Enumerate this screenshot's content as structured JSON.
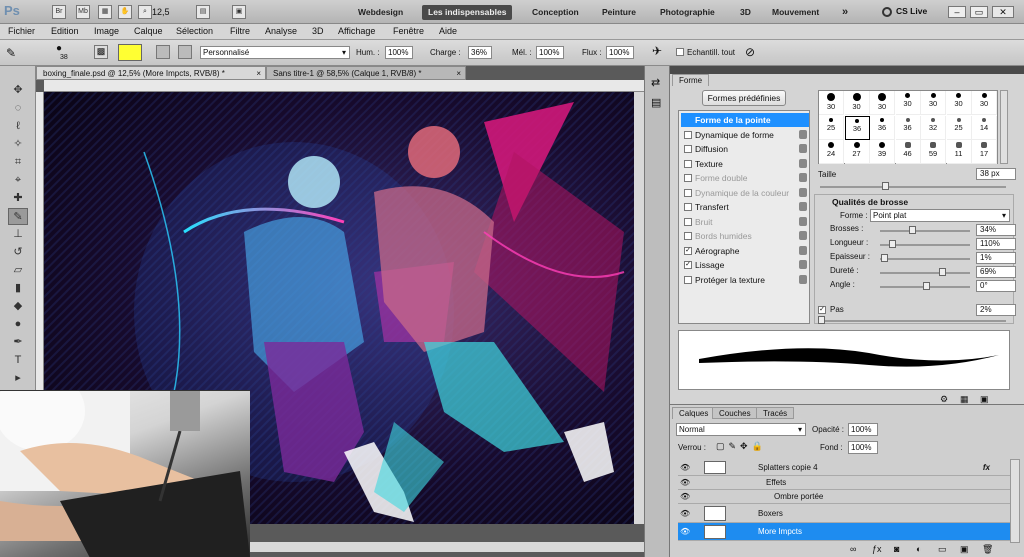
{
  "app": {
    "logo": "Ps",
    "zoom": "12,5",
    "cs_live": "CS Live"
  },
  "workspaces": [
    "Webdesign",
    "Les indispensables",
    "Conception",
    "Peinture",
    "Photographie",
    "3D",
    "Mouvement"
  ],
  "workspaces_more": "»",
  "menus": [
    "Fichier",
    "Edition",
    "Image",
    "Calque",
    "Sélection",
    "Filtre",
    "Analyse",
    "3D",
    "Affichage",
    "Fenêtre",
    "Aide"
  ],
  "options": {
    "brush_size": "38",
    "fg_color": "#ffff33",
    "preset": "Personnalisé",
    "hum_label": "Hum. :",
    "hum_value": "100%",
    "charge_label": "Charge :",
    "charge_value": "36%",
    "mel_label": "Mél. :",
    "mel_value": "100%",
    "flux_label": "Flux :",
    "flux_value": "100%",
    "sample_all": "Echantill. tout"
  },
  "tabs": [
    {
      "label": "boxing_finale.psd @ 12,5% (More Impcts, RVB/8) *",
      "close": "×"
    },
    {
      "label": "Sans titre-1 @ 58,5% (Calque 1, RVB/8) *",
      "close": "×"
    }
  ],
  "brush_panel": {
    "tab": "Forme",
    "presets_button": "Formes prédéfinies",
    "options": [
      {
        "label": "Forme de la pointe",
        "checkbox": false,
        "checked": false,
        "selected": true,
        "disabled": false
      },
      {
        "label": "Dynamique de forme",
        "checkbox": true,
        "checked": false,
        "selected": false,
        "disabled": false
      },
      {
        "label": "Diffusion",
        "checkbox": true,
        "checked": false,
        "selected": false,
        "disabled": false
      },
      {
        "label": "Texture",
        "checkbox": true,
        "checked": false,
        "selected": false,
        "disabled": false
      },
      {
        "label": "Forme double",
        "checkbox": true,
        "checked": false,
        "selected": false,
        "disabled": true
      },
      {
        "label": "Dynamique de la couleur",
        "checkbox": true,
        "checked": false,
        "selected": false,
        "disabled": true
      },
      {
        "label": "Transfert",
        "checkbox": true,
        "checked": false,
        "selected": false,
        "disabled": false
      },
      {
        "label": "Bruit",
        "checkbox": true,
        "checked": false,
        "selected": false,
        "disabled": true
      },
      {
        "label": "Bords humides",
        "checkbox": true,
        "checked": false,
        "selected": false,
        "disabled": true
      },
      {
        "label": "Aérographe",
        "checkbox": true,
        "checked": true,
        "selected": false,
        "disabled": false
      },
      {
        "label": "Lissage",
        "checkbox": true,
        "checked": true,
        "selected": false,
        "disabled": false
      },
      {
        "label": "Protéger la texture",
        "checkbox": true,
        "checked": false,
        "selected": false,
        "disabled": false
      }
    ],
    "tips": [
      "30",
      "30",
      "30",
      "30",
      "30",
      "30",
      "30",
      "25",
      "36",
      "36",
      "36",
      "32",
      "25",
      "14",
      "24",
      "27",
      "39",
      "46",
      "59",
      "11",
      "17"
    ],
    "size_label": "Taille",
    "size_value": "38 px",
    "qualities_title": "Qualités de brosse",
    "shape_label": "Forme :",
    "shape_value": "Point plat",
    "params": [
      {
        "label": "Brosses :",
        "value": "34%"
      },
      {
        "label": "Longueur :",
        "value": "110%"
      },
      {
        "label": "Epaisseur :",
        "value": "1%"
      },
      {
        "label": "Dureté :",
        "value": "69%"
      },
      {
        "label": "Angle :",
        "value": "0°"
      }
    ],
    "pas_label": "Pas",
    "pas_value": "2%"
  },
  "layers_panel": {
    "tabs": [
      "Calques",
      "Couches",
      "Tracés"
    ],
    "blend": "Normal",
    "opacity_label": "Opacité :",
    "opacity_value": "100%",
    "lock_label": "Verrou :",
    "fill_label": "Fond :",
    "fill_value": "100%",
    "layers": [
      {
        "name": "Splatters copie 4",
        "fx": "fx"
      },
      {
        "name": "Effets",
        "fx": ""
      },
      {
        "name": "Ombre portée",
        "fx": ""
      },
      {
        "name": "Boxers",
        "fx": ""
      },
      {
        "name": "More Impcts",
        "fx": ""
      }
    ],
    "footer_icons": [
      "link-icon",
      "fx-icon",
      "mask-icon",
      "adjustment-icon",
      "folder-icon",
      "new-layer-icon",
      "trash-icon"
    ]
  },
  "colors": {
    "accent": "#1e90ff",
    "selected_layer": "#1e8cf0"
  }
}
